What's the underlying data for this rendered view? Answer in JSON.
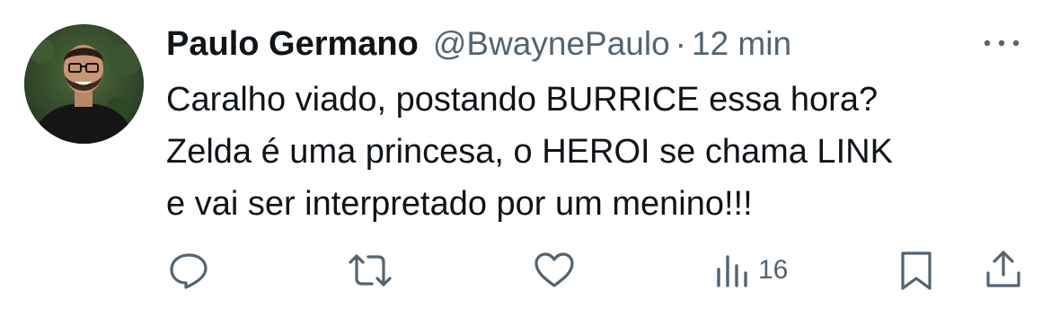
{
  "author": {
    "display_name": "Paulo Germano",
    "handle": "@BwaynePaulo",
    "separator": "·",
    "time": "12 min"
  },
  "tweet": {
    "lines": [
      "Caralho viado, postando BURRICE essa hora?",
      "Zelda é uma princesa, o HEROI se chama LINK",
      "e vai ser interpretado por um menino!!!"
    ]
  },
  "actions": {
    "views_count": "16"
  },
  "icons": {
    "reply": "reply-icon",
    "retweet": "retweet-icon",
    "like": "heart-icon",
    "views": "bar-chart-icon",
    "bookmark": "bookmark-icon",
    "share": "share-icon",
    "more": "more-icon"
  },
  "colors": {
    "text": "#0f1419",
    "muted": "#536471"
  }
}
